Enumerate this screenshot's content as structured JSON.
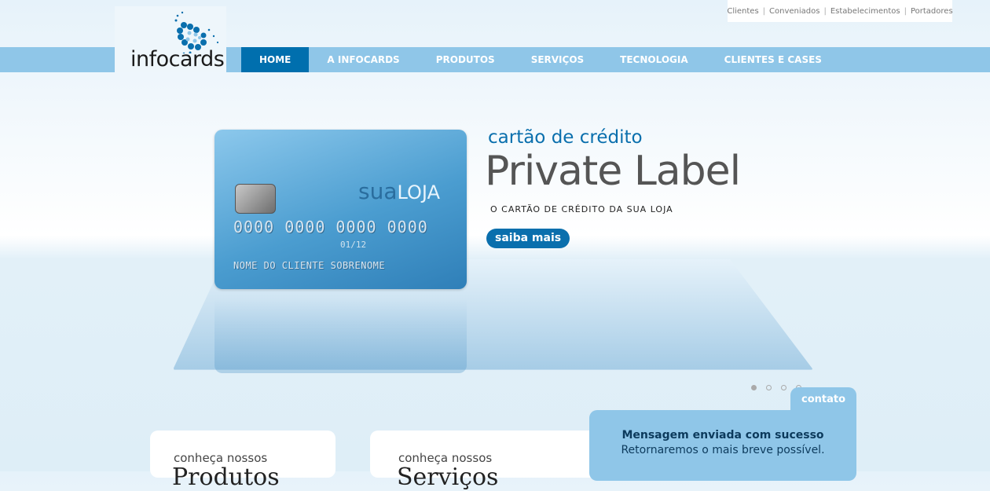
{
  "top_links": [
    "Clientes",
    "Conveniados",
    "Estabelecimentos",
    "Portadores"
  ],
  "logo": {
    "text": "infocards"
  },
  "nav": [
    {
      "label": "HOME",
      "active": true
    },
    {
      "label": "A INFOCARDS"
    },
    {
      "label": "PRODUTOS"
    },
    {
      "label": "SERVIÇOS"
    },
    {
      "label": "TECNOLOGIA"
    },
    {
      "label": "CLIENTES E CASES"
    }
  ],
  "slide": {
    "subtitle": "cartão de crédito",
    "title": "Private Label",
    "tagline": "O CARTÃO DE CRÉDITO DA SUA LOJA",
    "button": "saiba mais",
    "card": {
      "brand_a": "sua",
      "brand_b": "LOJA",
      "number": "0000 0000 0000 0000",
      "expiry": "01/12",
      "name": "NOME DO CLIENTE SOBRENOME"
    },
    "pager": {
      "count": 4,
      "active": 1
    }
  },
  "boxes": [
    {
      "kicker": "conheça nossos",
      "title": "Produtos"
    },
    {
      "kicker": "conheça nossos",
      "title": "Serviços"
    }
  ],
  "contact": {
    "tab": "contato",
    "message": "Mensagem enviada com sucesso",
    "detail": "Retornaremos o mais breve possível."
  }
}
